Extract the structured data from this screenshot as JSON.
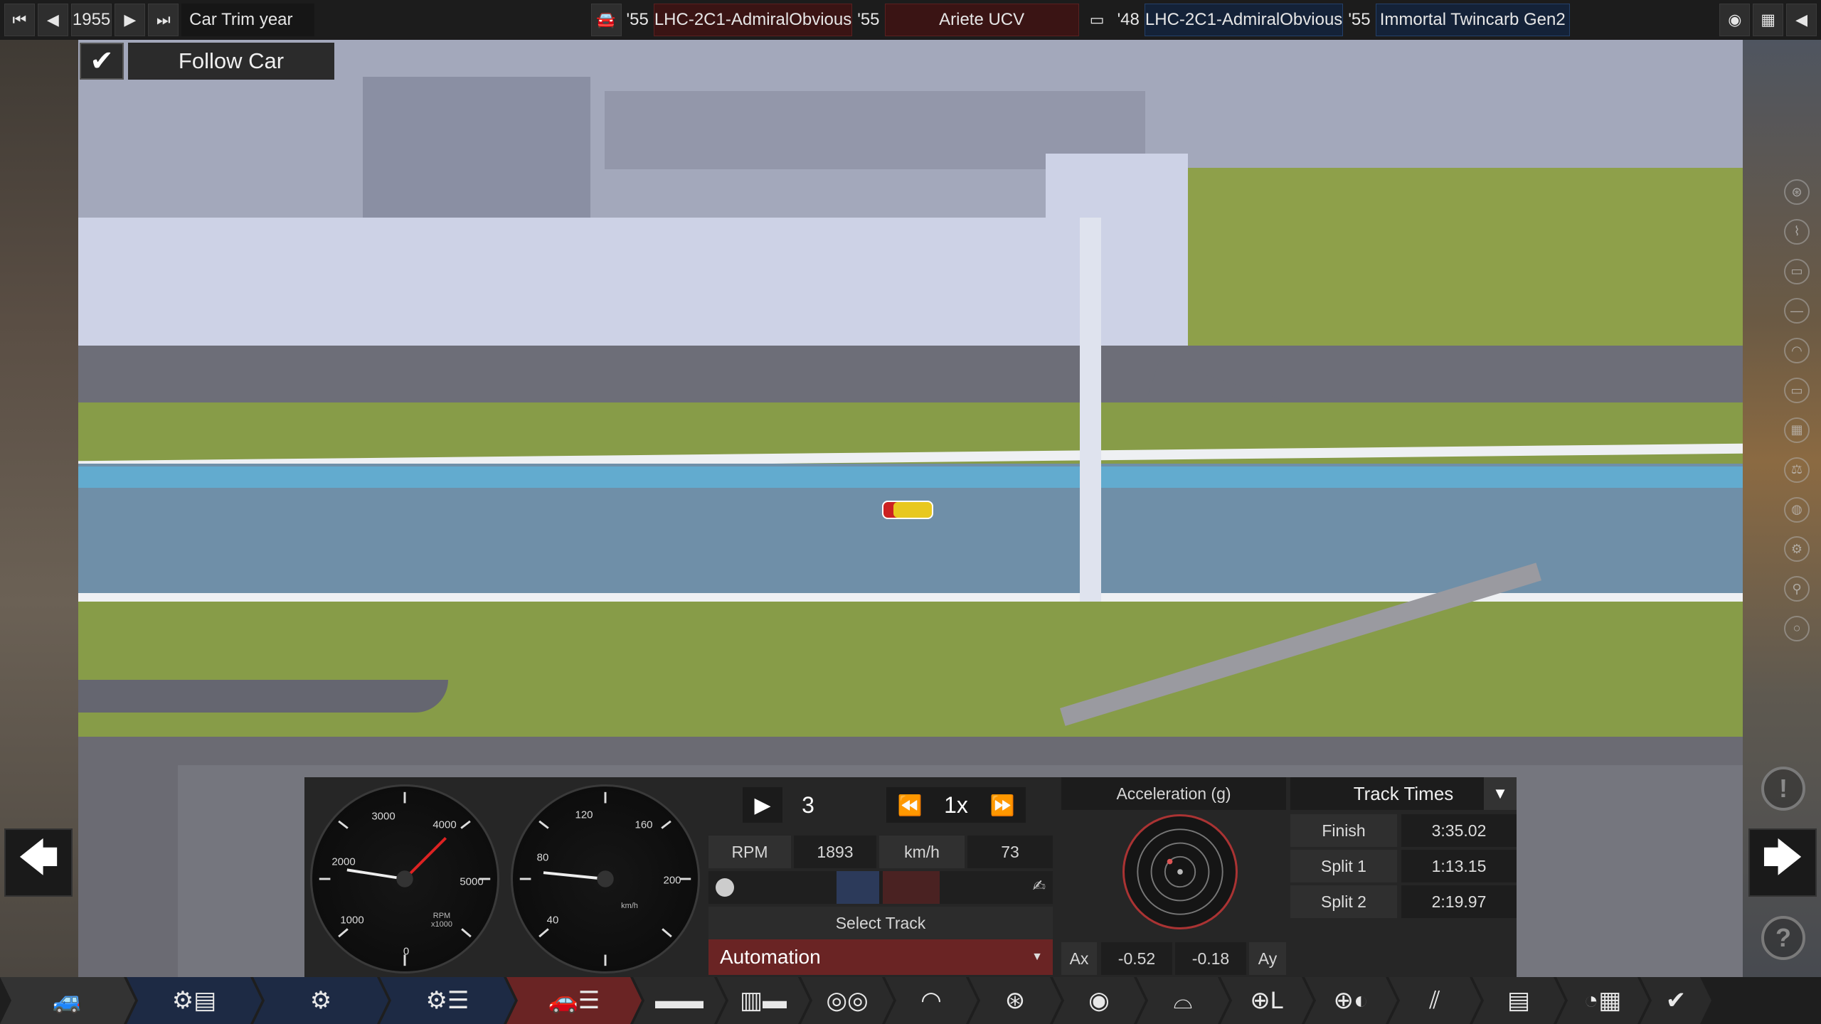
{
  "topbar": {
    "year": "1955",
    "trim_label": "Car Trim year",
    "car_year": "'55",
    "car_model": "LHC-2C1-AdmiralObvious",
    "car_trim_year": "'55",
    "trim_name": "Ariete UCV",
    "engine_year": "'48",
    "engine_family": "LHC-2C1-AdmiralObvious",
    "engine_variant_year": "'55",
    "engine_variant": "Immortal Twincarb Gen2"
  },
  "follow_car": {
    "checked": true,
    "label": "Follow Car"
  },
  "tachometer": {
    "ticks": [
      "0",
      "1000",
      "2000",
      "3000",
      "4000",
      "5000"
    ],
    "unit_line1": "RPM",
    "unit_line2": "x1000",
    "needle_value": 1893
  },
  "speedometer": {
    "ticks": [
      "40",
      "80",
      "120",
      "160",
      "200"
    ],
    "unit": "km/h",
    "needle_value": 73
  },
  "playback": {
    "lap": "3",
    "speed": "1x"
  },
  "readouts": {
    "rpm_label": "RPM",
    "rpm_value": "1893",
    "speed_label": "km/h",
    "speed_value": "73"
  },
  "track": {
    "select_label": "Select Track",
    "selected": "Automation"
  },
  "acceleration": {
    "title": "Acceleration (g)",
    "ax_label": "Ax",
    "ax_value": "-0.52",
    "ay_value": "-0.18",
    "ay_label": "Ay"
  },
  "track_times": {
    "title": "Track Times",
    "rows": [
      {
        "label": "Finish",
        "value": "3:35.02"
      },
      {
        "label": "Split 1",
        "value": "1:13.15"
      },
      {
        "label": "Split 2",
        "value": "2:19.97"
      }
    ]
  },
  "colors": {
    "grass": "#7f9a3f",
    "asphalt": "#6b6b73",
    "water": "#5a9fc4",
    "accent_red": "#6a2424",
    "accent_blue": "#1d2a44"
  }
}
